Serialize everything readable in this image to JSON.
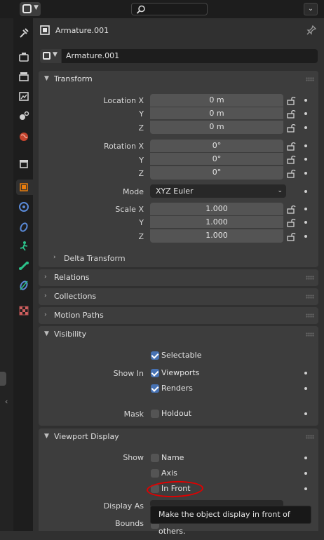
{
  "header": {
    "title": "Armature.001",
    "datablock_name": "Armature.001"
  },
  "search": {
    "placeholder": ""
  },
  "tabs": [
    "tool-icon",
    "render-icon",
    "output-icon",
    "view-layer-icon",
    "scene-icon",
    "world-icon",
    "collection-icon",
    "object-icon",
    "modifiers-icon",
    "particles-icon",
    "physics-icon",
    "object-constraints-icon",
    "object-data-icon",
    "bone-constraint-icon",
    "texture-icon"
  ],
  "transform": {
    "title": "Transform",
    "location": {
      "label_x": "Location X",
      "label_y": "Y",
      "label_z": "Z",
      "x": "0 m",
      "y": "0 m",
      "z": "0 m"
    },
    "rotation": {
      "label_x": "Rotation X",
      "label_y": "Y",
      "label_z": "Z",
      "x": "0°",
      "y": "0°",
      "z": "0°"
    },
    "mode": {
      "label": "Mode",
      "value": "XYZ Euler"
    },
    "scale": {
      "label_x": "Scale X",
      "label_y": "Y",
      "label_z": "Z",
      "x": "1.000",
      "y": "1.000",
      "z": "1.000"
    },
    "delta": "Delta Transform"
  },
  "panels": {
    "relations": "Relations",
    "collections": "Collections",
    "motion_paths": "Motion Paths"
  },
  "visibility": {
    "title": "Visibility",
    "selectable": "Selectable",
    "show_in_label": "Show In",
    "viewports": "Viewports",
    "renders": "Renders",
    "mask_label": "Mask",
    "holdout": "Holdout"
  },
  "viewport_display": {
    "title": "Viewport Display",
    "show_label": "Show",
    "name": "Name",
    "axis": "Axis",
    "in_front": "In Front",
    "display_as_label": "Display As",
    "bounds_label": "Bounds"
  },
  "tooltip": "Make the object display in front of others.",
  "colors": {
    "accent": "#4772b3",
    "annotation": "#e00000",
    "object_tab": "#e87d0d"
  }
}
